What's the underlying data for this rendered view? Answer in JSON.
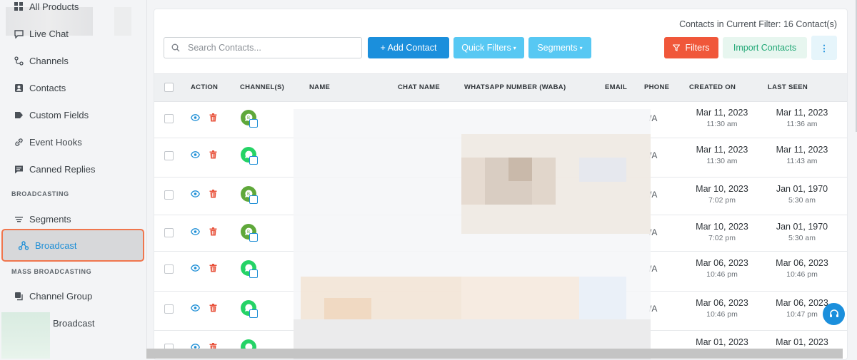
{
  "sidebar": {
    "items": [
      {
        "label": "All Products",
        "icon": "grid-icon"
      },
      {
        "label": "Live Chat",
        "icon": "chat-icon"
      },
      {
        "label": "Channels",
        "icon": "channels-icon"
      },
      {
        "label": "Contacts",
        "icon": "contacts-icon"
      },
      {
        "label": "Custom Fields",
        "icon": "tag-icon"
      },
      {
        "label": "Event Hooks",
        "icon": "link-icon"
      },
      {
        "label": "Canned Replies",
        "icon": "message-icon"
      }
    ],
    "section_broadcasting": "BROADCASTING",
    "segments_label": "Segments",
    "broadcast_label": "Broadcast",
    "section_mass": "MASS BROADCASTING",
    "channel_group_label": "Channel Group",
    "mass_broadcast_label": "Broadcast"
  },
  "toolbar": {
    "filter_count": "Contacts in Current Filter: 16 Contact(s)",
    "search_placeholder": "Search Contacts...",
    "add_contact": "+ Add Contact",
    "quick_filters": "Quick Filters",
    "segments": "Segments",
    "filters": "Filters",
    "import_contacts": "Import Contacts",
    "more": "⋮"
  },
  "table": {
    "headers": {
      "action": "ACTION",
      "channels": "CHANNEL(S)",
      "name": "NAME",
      "chat_name": "CHAT NAME",
      "whatsapp": "WHATSAPP NUMBER (WABA)",
      "email": "EMAIL",
      "phone": "PHONE",
      "created_on": "CREATED ON",
      "last_seen": "LAST SEEN"
    },
    "rows": [
      {
        "channel": "whatsapp-business",
        "phone": "/A",
        "created_date": "Mar 11, 2023",
        "created_time": "11:30 am",
        "seen_date": "Mar 11, 2023",
        "seen_time": "11:36 am"
      },
      {
        "channel": "whatsapp",
        "phone": "/A",
        "created_date": "Mar 11, 2023",
        "created_time": "11:30 am",
        "seen_date": "Mar 11, 2023",
        "seen_time": "11:43 am"
      },
      {
        "channel": "whatsapp-business",
        "phone": "/A",
        "created_date": "Mar 10, 2023",
        "created_time": "7:02 pm",
        "seen_date": "Jan 01, 1970",
        "seen_time": "5:30 am"
      },
      {
        "channel": "whatsapp-business",
        "phone": "/A",
        "created_date": "Mar 10, 2023",
        "created_time": "7:02 pm",
        "seen_date": "Jan 01, 1970",
        "seen_time": "5:30 am"
      },
      {
        "channel": "whatsapp",
        "phone": "/A",
        "created_date": "Mar 06, 2023",
        "created_time": "10:46 pm",
        "seen_date": "Mar 06, 2023",
        "seen_time": "10:46 pm"
      },
      {
        "channel": "whatsapp",
        "phone": "/A",
        "created_date": "Mar 06, 2023",
        "created_time": "10:46 pm",
        "seen_date": "Mar 06, 2023",
        "seen_time": "10:47 pm"
      },
      {
        "channel": "whatsapp",
        "phone": "",
        "created_date": "Mar 01, 2023",
        "created_time": "",
        "seen_date": "Mar 01, 2023",
        "seen_time": ""
      }
    ]
  },
  "colors": {
    "accent": "#1b8fdc",
    "danger": "#f0573a",
    "whatsapp": "#25d366",
    "whatsapp_business": "#5fa83a",
    "active_border": "#f0764d"
  }
}
